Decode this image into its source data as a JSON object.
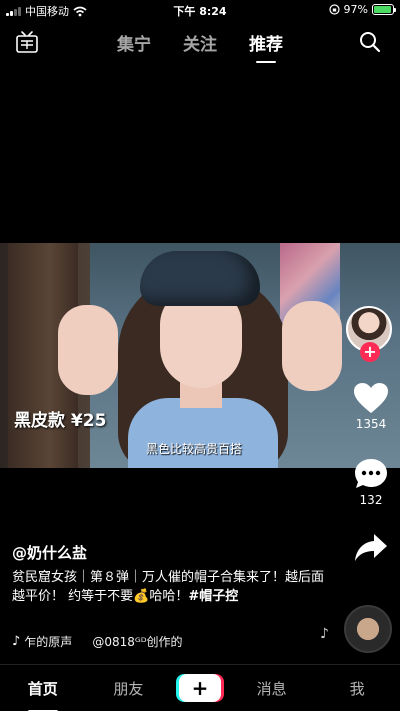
{
  "status_bar": {
    "carrier": "中国移动",
    "time": "下午 8:24",
    "battery": "97%",
    "battery_level": 0.97
  },
  "top_nav": {
    "live_icon": "live-tv-icon",
    "tabs": [
      "集宁",
      "关注",
      "推荐"
    ],
    "active_tab": "推荐",
    "search_icon": "search-icon"
  },
  "video": {
    "overlay_caption": "黑皮款 ¥25",
    "subtitle": "黑色比较高贵百搭"
  },
  "actions": {
    "likes": "1354",
    "comments": "132"
  },
  "post": {
    "author": "@奶什么盐",
    "description": "贫民窟女孩｜第８弹｜万人催的帽子合集来了！越后面越平价！ 约等于不要💰哈哈！",
    "hashtag": "#帽子控",
    "music_line1": "乍的原声",
    "music_line2": "@0818ᴳᴰ创作的"
  },
  "bottom_tabs": {
    "home": "首页",
    "friends": "朋友",
    "create": "+",
    "messages": "消息",
    "me": "我"
  },
  "colors": {
    "accent_red": "#fe2c55",
    "accent_cyan": "#25f4ee",
    "battery_green": "#4cd964"
  }
}
